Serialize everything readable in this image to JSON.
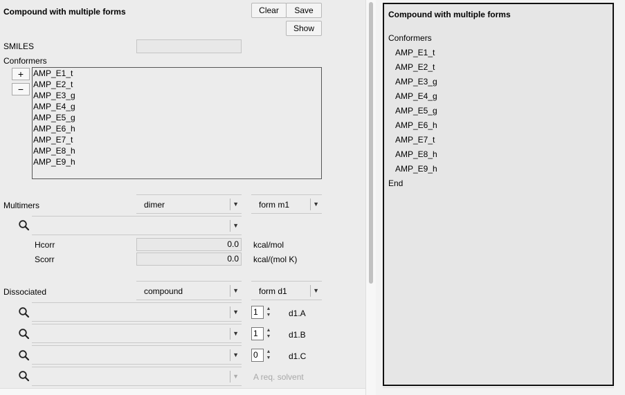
{
  "form": {
    "title": "Compound with  multiple forms",
    "buttons": {
      "clear": "Clear",
      "save": "Save",
      "show": "Show"
    },
    "smiles_label": "SMILES",
    "smiles_value": "",
    "conformers_label": "Conformers",
    "add_symbol": "+",
    "remove_symbol": "−",
    "conformers": [
      "AMP_E1_t",
      "AMP_E2_t",
      "AMP_E3_g",
      "AMP_E4_g",
      "AMP_E5_g",
      "AMP_E6_h",
      "AMP_E7_t",
      "AMP_E8_h",
      "AMP_E9_h"
    ],
    "multimers": {
      "label": "Multimers",
      "type": "dimer",
      "form": "form m1",
      "search_value": "",
      "hcorr_label": "Hcorr",
      "hcorr_value": "0.0",
      "hcorr_unit": "kcal/mol",
      "scorr_label": "Scorr",
      "scorr_value": "0.0",
      "scorr_unit": "kcal/(mol K)"
    },
    "dissociated": {
      "label": "Dissociated",
      "type": "compound",
      "form": "form d1",
      "rows": [
        {
          "value": "",
          "count": "1",
          "name": "d1.A"
        },
        {
          "value": "",
          "count": "1",
          "name": "d1.B"
        },
        {
          "value": "",
          "count": "0",
          "name": "d1.C"
        }
      ],
      "solvent_label": "A req. solvent"
    }
  },
  "output": {
    "title": "Compound with  multiple forms",
    "conformers_heading": "Conformers",
    "conformers": [
      "AMP_E1_t",
      "AMP_E2_t",
      "AMP_E3_g",
      "AMP_E4_g",
      "AMP_E5_g",
      "AMP_E6_h",
      "AMP_E7_t",
      "AMP_E8_h",
      "AMP_E9_h"
    ],
    "end": "End"
  }
}
